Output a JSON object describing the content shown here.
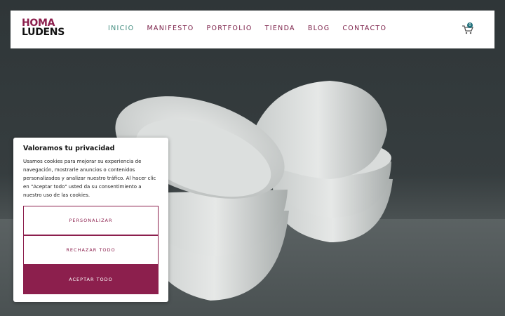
{
  "brand": {
    "line1": "HOMA",
    "line2": "LUDENS"
  },
  "nav": {
    "items": [
      {
        "label": "INICIO",
        "active": true
      },
      {
        "label": "MANIFESTO"
      },
      {
        "label": "PORTFOLIO"
      },
      {
        "label": "TIENDA"
      },
      {
        "label": "BLOG"
      },
      {
        "label": "CONTACTO"
      }
    ]
  },
  "cart": {
    "icon": "cart-icon",
    "count": "0"
  },
  "cookie": {
    "title": "Valoramos tu privacidad",
    "body": "Usamos cookies para mejorar su experiencia de navegación, mostrarle anuncios o contenidos personalizados y analizar nuestro tráfico. Al hacer clic en \"Aceptar todo\" usted da su consentimiento a nuestro uso de las cookies.",
    "customize_label": "PERSONALIZAR",
    "reject_label": "RECHAZAR TODO",
    "accept_label": "ACEPTAR TODO"
  },
  "colors": {
    "brand": "#8c1f4d",
    "nav_active": "#3e8a7c",
    "cart_badge": "#1f6f7a"
  }
}
